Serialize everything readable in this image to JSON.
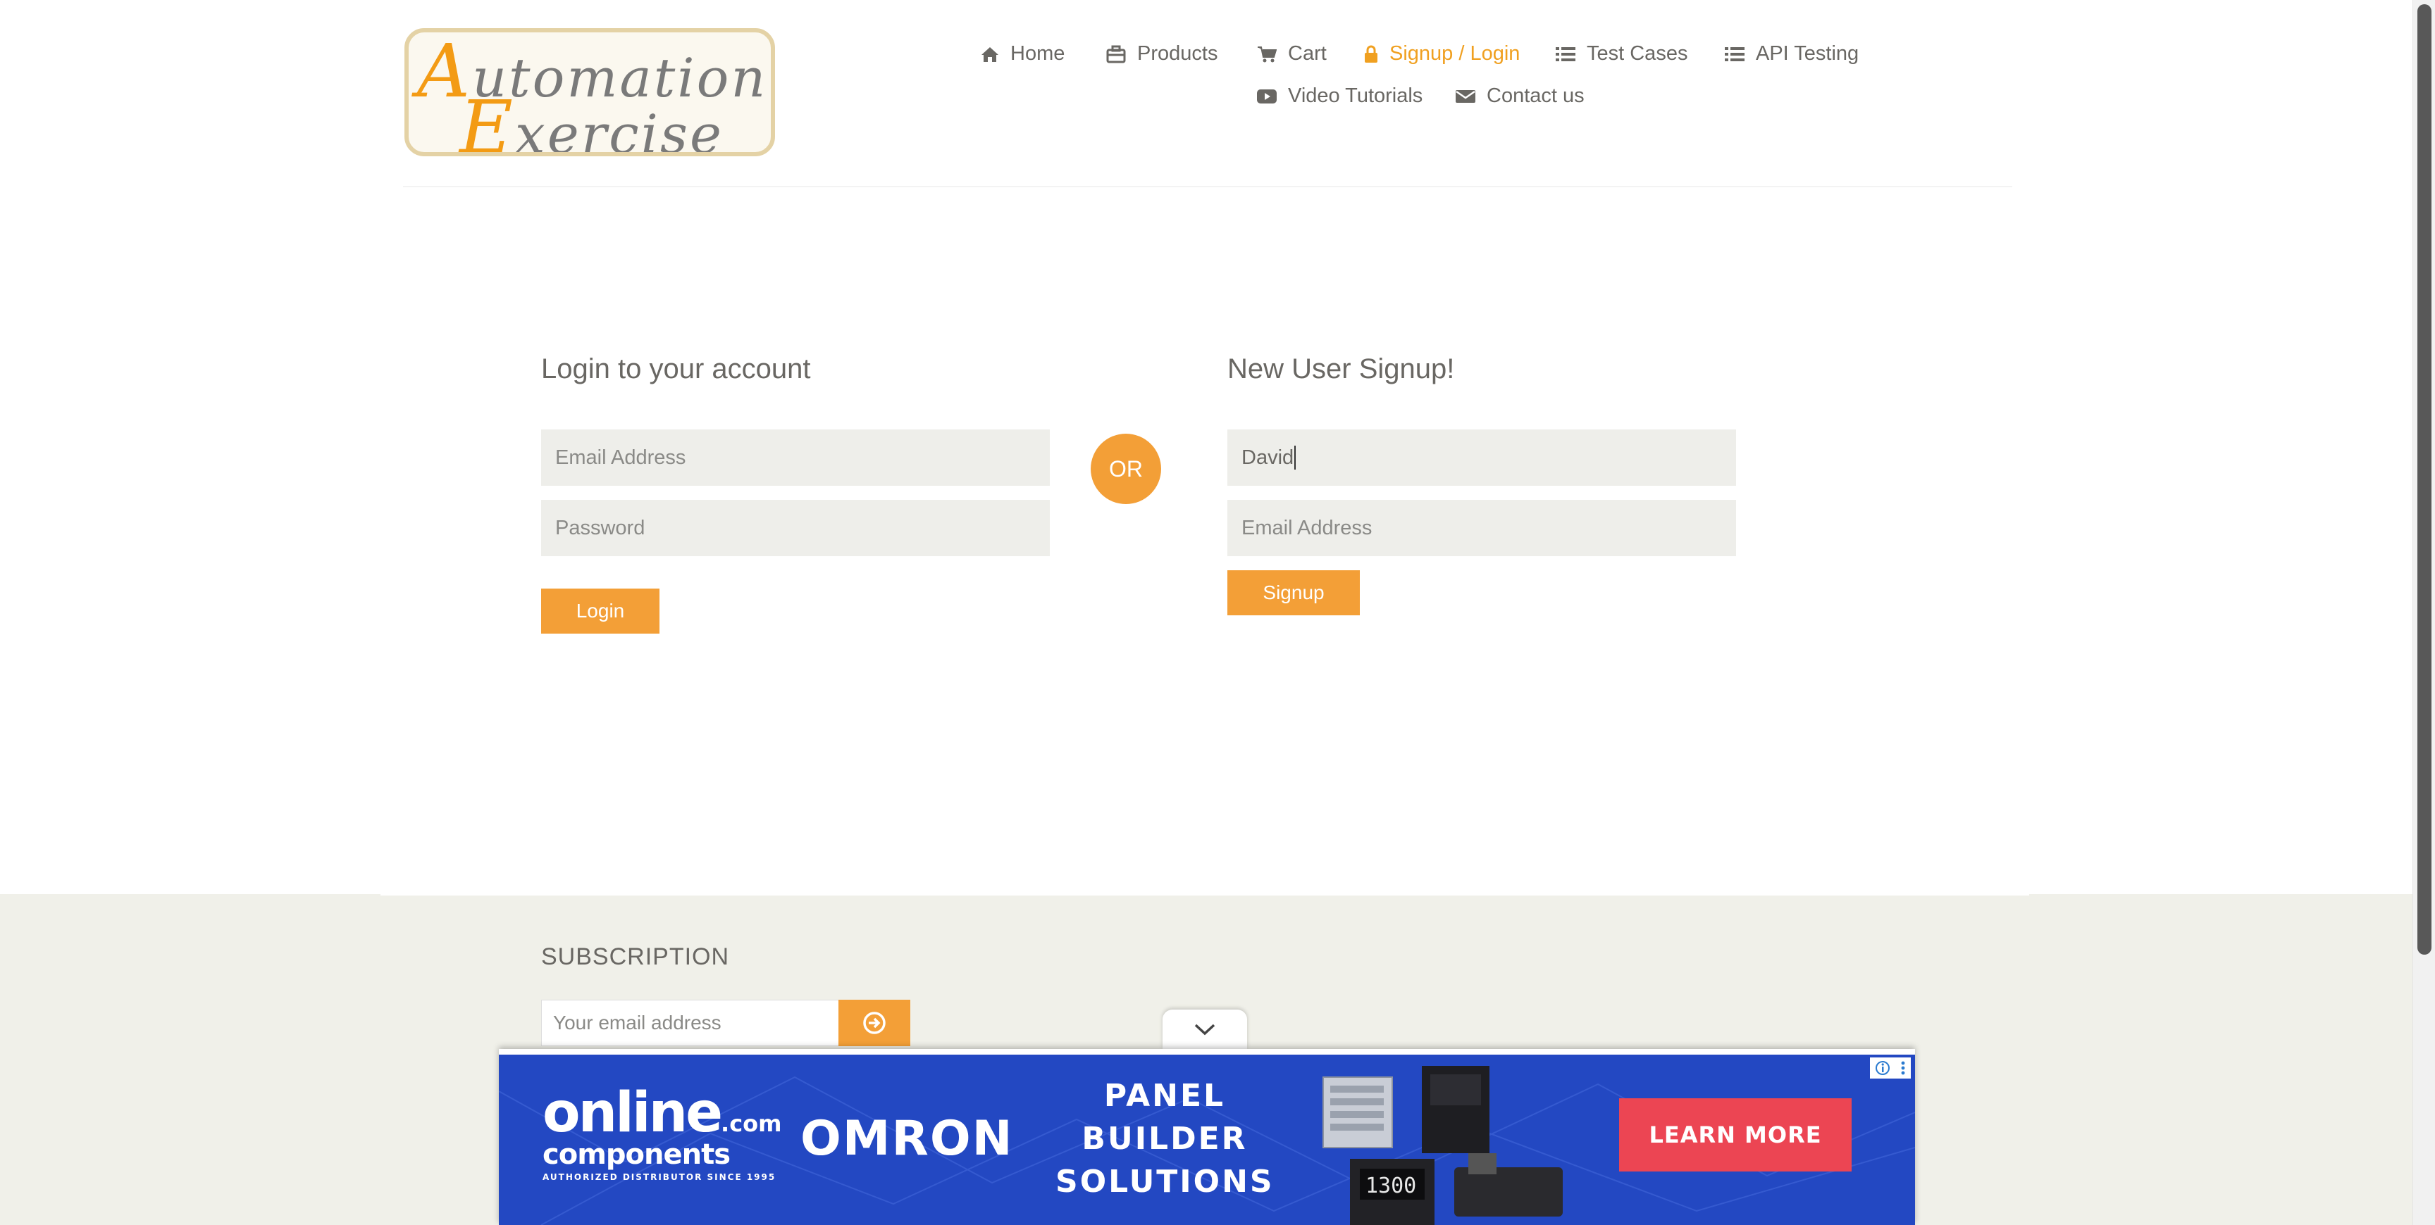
{
  "header": {
    "logo_line1": "utomation",
    "logo_line1_initial": "A",
    "logo_line2": "xercise",
    "logo_line2_initial": "E",
    "nav": [
      {
        "label": "Home",
        "icon": "home-icon"
      },
      {
        "label": "Products",
        "icon": "briefcase-icon"
      },
      {
        "label": "Cart",
        "icon": "cart-icon"
      },
      {
        "label": "Signup / Login",
        "icon": "lock-icon",
        "active": true
      },
      {
        "label": "Test Cases",
        "icon": "list-icon"
      },
      {
        "label": "API Testing",
        "icon": "list-icon"
      },
      {
        "label": "Video Tutorials",
        "icon": "youtube-play-icon"
      },
      {
        "label": "Contact us",
        "icon": "envelope-icon"
      }
    ]
  },
  "login": {
    "title": "Login to your account",
    "email_placeholder": "Email Address",
    "password_placeholder": "Password",
    "button": "Login"
  },
  "or_label": "OR",
  "signup": {
    "title": "New User Signup!",
    "name_value": "David",
    "email_placeholder": "Email Address",
    "button": "Signup"
  },
  "footer": {
    "subscription_title": "SUBSCRIPTION",
    "email_placeholder": "Your email address"
  },
  "ad": {
    "brand_line1": "online",
    "brand_line2": "components",
    "brand_suffix": ".com",
    "brand_tagline": "AUTHORIZED DISTRIBUTOR SINCE 1995",
    "partner": "OMRON",
    "headline": [
      "PANEL",
      "BUILDER",
      "SOLUTIONS"
    ],
    "cta": "LEARN MORE",
    "device_readout": "1300"
  },
  "colors": {
    "accent": "#F39F37",
    "active_nav": "#F0A020",
    "ad_background": "#2348C2",
    "ad_cta": "#EC4553",
    "footer_background": "#F0F0E9",
    "field_background": "#EEEEEA"
  }
}
